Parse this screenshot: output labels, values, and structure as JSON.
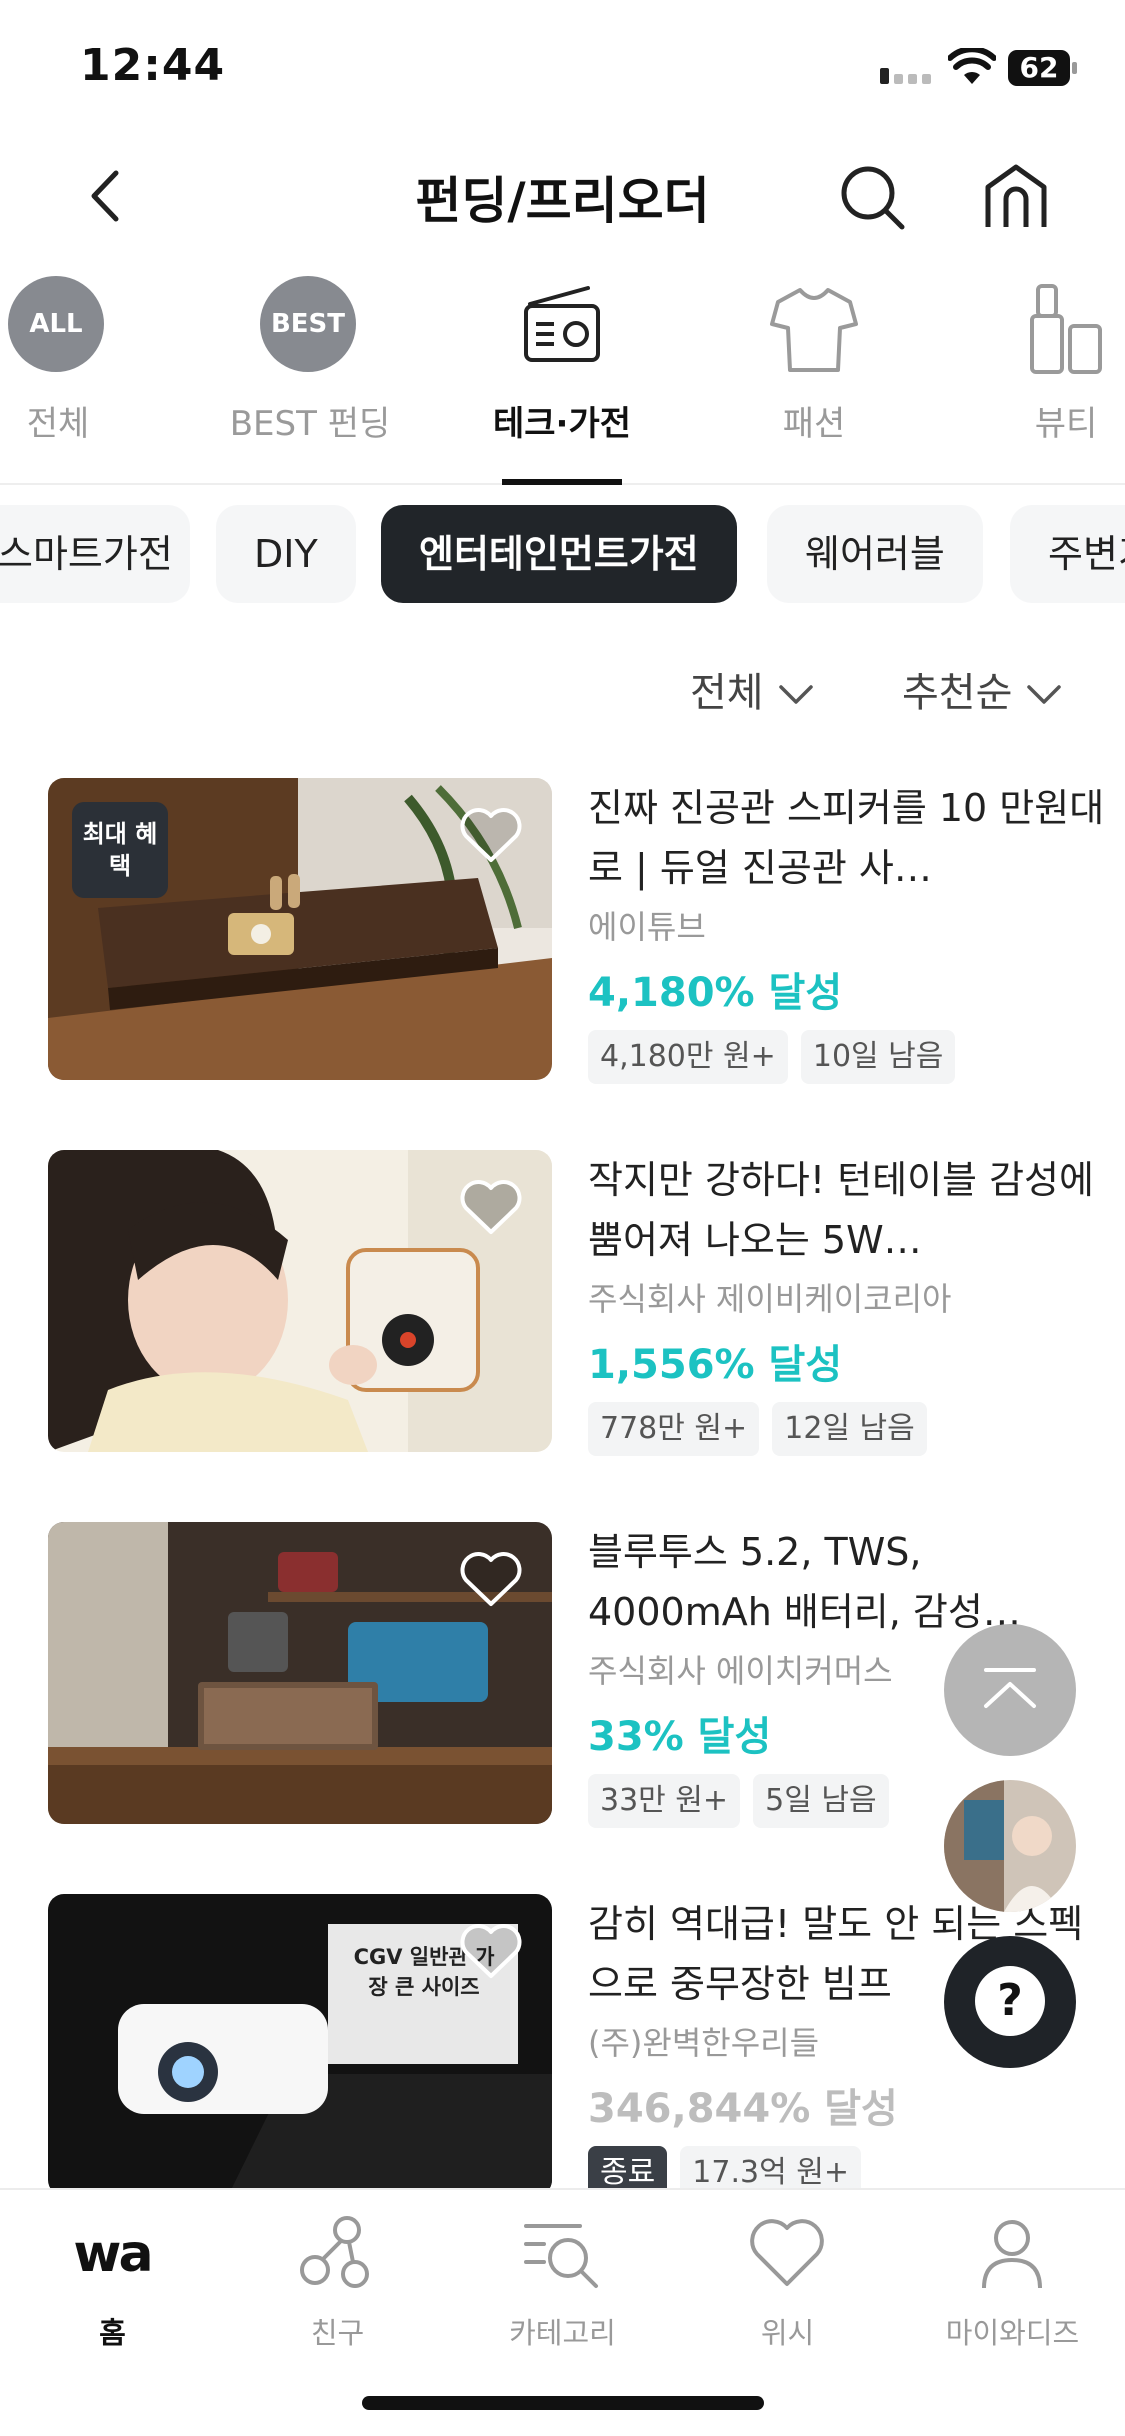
{
  "status": {
    "time": "12:44",
    "battery": "62"
  },
  "header": {
    "title": "펀딩/프리오더"
  },
  "categories": [
    {
      "label": "전체",
      "badge": "ALL",
      "icon": "all-badge"
    },
    {
      "label": "BEST 펀딩",
      "badge": "BEST",
      "icon": "best-badge"
    },
    {
      "label": "테크·가전",
      "icon": "radio-icon",
      "active": true
    },
    {
      "label": "패션",
      "icon": "tshirt-icon"
    },
    {
      "label": "뷰티",
      "icon": "cosmetics-icon"
    }
  ],
  "chips": [
    "스마트가전",
    "DIY",
    "엔터테인먼트가전",
    "웨어러블",
    "주변기"
  ],
  "filters": {
    "scope": "전체",
    "sort": "추천순"
  },
  "products": [
    {
      "name": "진짜 진공관 스피커를 10 만원대로 | 듀얼 진공관 사…",
      "seller": "에이튜브",
      "rate": "4,180% 달성",
      "badge": "최대 혜택",
      "tags": [
        "4,180만 원+",
        "10일 남음"
      ]
    },
    {
      "name": "작지만 강하다! 턴테이블 감성에 뿜어져 나오는 5W…",
      "seller": "주식회사 제이비케이코리아",
      "rate": "1,556% 달성",
      "tags": [
        "778만 원+",
        "12일 남음"
      ]
    },
    {
      "name": "블루투스 5.2, TWS, 4000mAh 배터리, 감성…",
      "seller": "주식회사 에이치커머스",
      "rate": "33% 달성",
      "tags": [
        "33만 원+",
        "5일 남음"
      ]
    },
    {
      "name": "감히 역대급! 말도 안 되는 스펙으로 중무장한 빔프",
      "seller": "(주)완벽한우리들",
      "rate": "346,844% 달성",
      "image_text": "CGV 일반관 가장 큰 사이즈",
      "tags": [
        "종료",
        "17.3억 원+"
      ]
    }
  ],
  "fab": {
    "help": "?"
  },
  "bottomnav": [
    {
      "label": "홈",
      "logo": "wa",
      "active": true
    },
    {
      "label": "친구",
      "icon": "friends-icon"
    },
    {
      "label": "카테고리",
      "icon": "category-search-icon"
    },
    {
      "label": "위시",
      "icon": "heart-icon"
    },
    {
      "label": "마이와디즈",
      "icon": "person-icon"
    }
  ],
  "colors": {
    "accent": "#1cc2c2",
    "dark": "#212529",
    "muted": "#9a9a9a"
  }
}
